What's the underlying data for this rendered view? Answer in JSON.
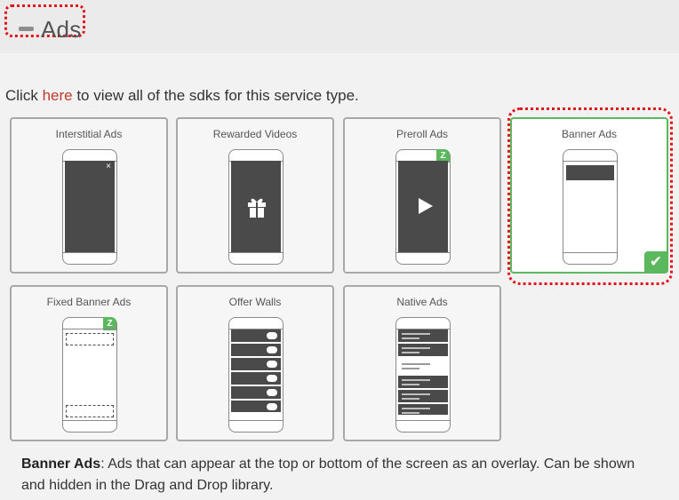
{
  "header": {
    "title": "Ads"
  },
  "intro": {
    "prefix": "Click ",
    "link": "here",
    "suffix": " to view all of the sdks for this service type."
  },
  "cards": [
    {
      "label": "Interstitial Ads",
      "badge": "",
      "selected": false
    },
    {
      "label": "Rewarded Videos",
      "badge": "",
      "selected": false
    },
    {
      "label": "Preroll Ads",
      "badge": "Z",
      "selected": false
    },
    {
      "label": "Banner Ads",
      "badge": "",
      "selected": true,
      "check": "✔"
    },
    {
      "label": "Fixed Banner Ads",
      "badge": "Z",
      "selected": false
    },
    {
      "label": "Offer Walls",
      "badge": "",
      "selected": false
    },
    {
      "label": "Native Ads",
      "badge": "",
      "selected": false
    }
  ],
  "interstitial": {
    "close": "×"
  },
  "description": {
    "term": "Banner Ads",
    "text": ": Ads that can appear at the top or bottom of the screen as an overlay. Can be shown and hidden in the Drag and Drop library."
  },
  "colors": {
    "accent_green": "#5cb85c",
    "link_red": "#c0392b",
    "highlight_red": "#e0161c"
  }
}
